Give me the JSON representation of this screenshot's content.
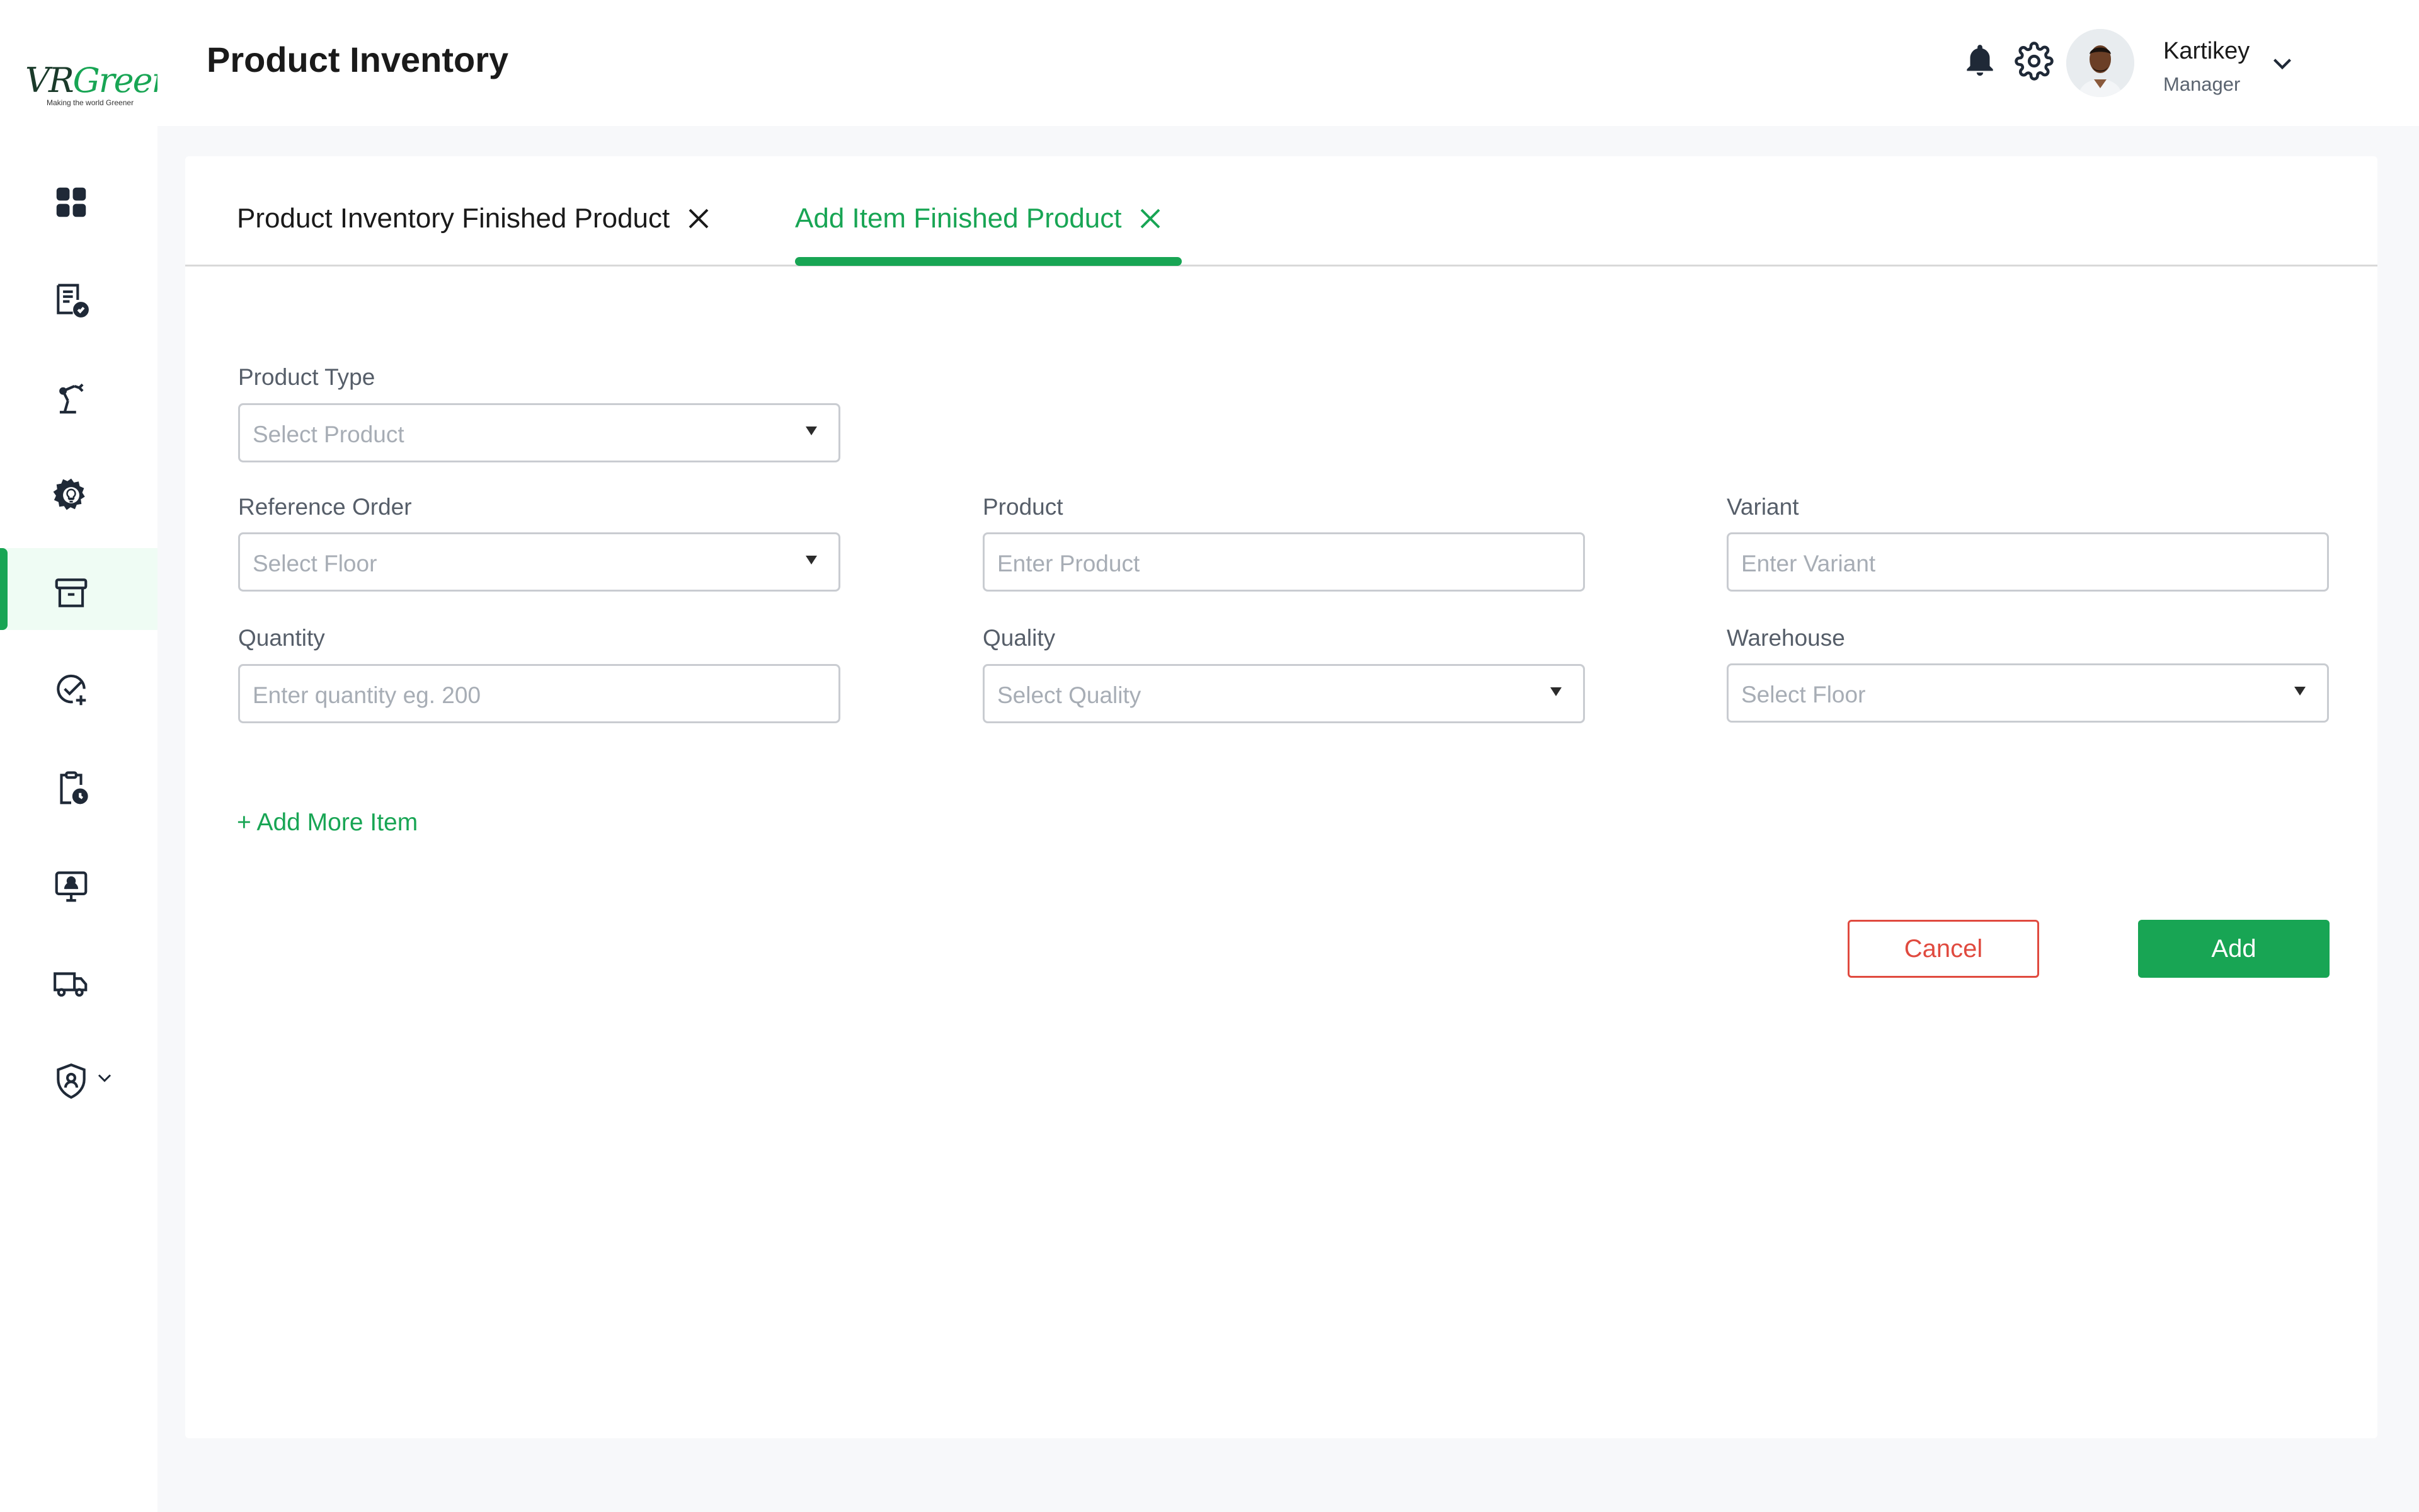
{
  "brand": {
    "logo_prefix": "VR",
    "logo_word": "Green",
    "tagline": "Making the world Greener",
    "accent": "#18a554",
    "danger": "#e04a3f"
  },
  "sidebar": {
    "items": [
      {
        "icon": "dashboard-grid-icon",
        "active": false
      },
      {
        "icon": "orders-checklist-icon",
        "active": false
      },
      {
        "icon": "robot-arm-icon",
        "active": false
      },
      {
        "icon": "gear-bulb-icon",
        "active": false
      },
      {
        "icon": "archive-box-icon",
        "active": true
      },
      {
        "icon": "check-circle-plus-icon",
        "active": false
      },
      {
        "icon": "clipboard-clock-icon",
        "active": false
      },
      {
        "icon": "monitor-user-icon",
        "active": false
      },
      {
        "icon": "truck-icon",
        "active": false
      },
      {
        "icon": "shield-user-icon",
        "active": false,
        "has_dropdown": true
      }
    ]
  },
  "header": {
    "title": "Product Inventory",
    "user": {
      "name": "Kartikey",
      "role": "Manager"
    }
  },
  "tabs": [
    {
      "label": "Product Inventory Finished Product",
      "active": false
    },
    {
      "label": "Add Item Finished Product",
      "active": true
    }
  ],
  "form": {
    "product_type": {
      "label": "Product Type",
      "placeholder": "Select Product"
    },
    "reference_order": {
      "label": "Reference Order",
      "placeholder": "Select Floor"
    },
    "product": {
      "label": "Product",
      "placeholder": "Enter Product"
    },
    "variant": {
      "label": "Variant",
      "placeholder": "Enter Variant"
    },
    "quantity": {
      "label": "Quantity",
      "placeholder": "Enter quantity eg. 200"
    },
    "quality": {
      "label": "Quality",
      "placeholder": "Select Quality"
    },
    "warehouse": {
      "label": "Warehouse",
      "placeholder": "Select Floor"
    },
    "add_more": "+ Add More Item",
    "cancel": "Cancel",
    "add": "Add"
  }
}
